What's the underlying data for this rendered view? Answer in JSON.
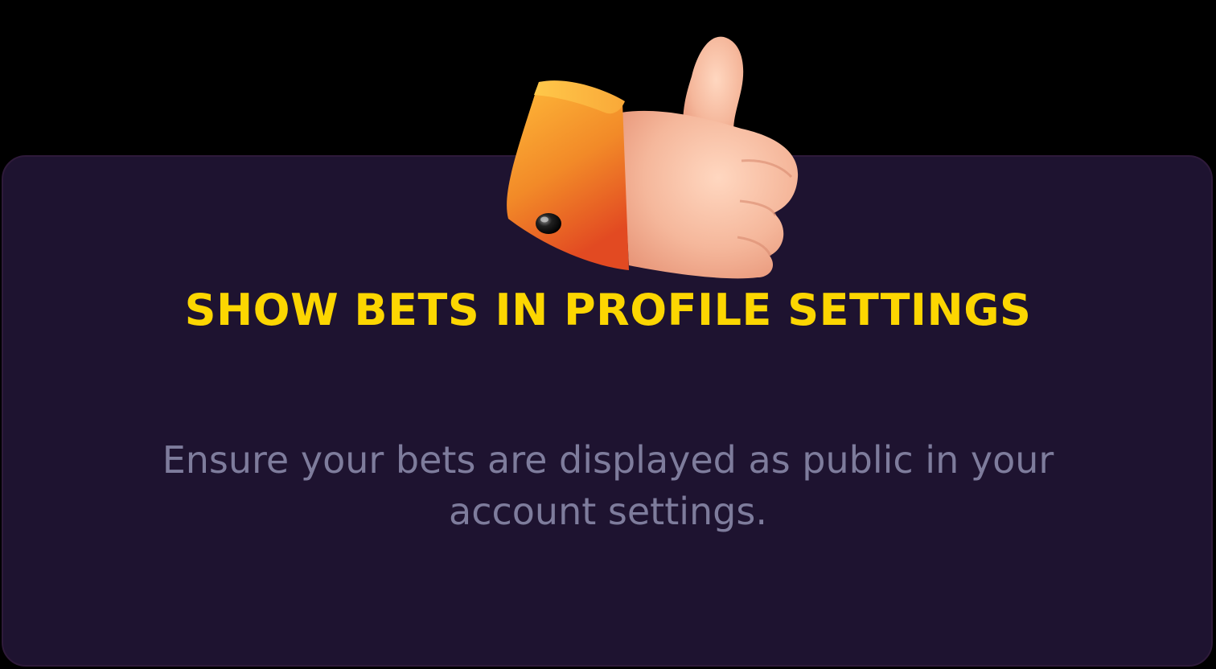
{
  "card": {
    "title": "SHOW BETS IN PROFILE SETTINGS",
    "description": "Ensure your bets are displayed as public in your account settings."
  },
  "icon": {
    "name": "thumbs-up-icon"
  },
  "colors": {
    "background": "#000000",
    "card": "#1e1330",
    "title": "#fcd601",
    "description": "#7e7c9c",
    "skin": "#f2b89f",
    "cuff": "#f5a030"
  }
}
